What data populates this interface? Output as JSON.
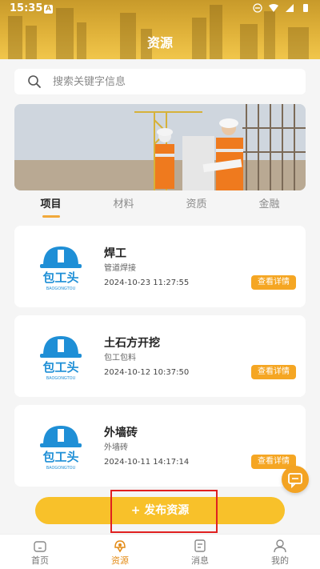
{
  "status_bar": {
    "time": "15:35",
    "app_badge": "A"
  },
  "header": {
    "title": "资源"
  },
  "search": {
    "placeholder": "搜索关键字信息"
  },
  "tabs": [
    {
      "label": "项目",
      "active": true
    },
    {
      "label": "材料",
      "active": false
    },
    {
      "label": "资质",
      "active": false
    },
    {
      "label": "金融",
      "active": false
    }
  ],
  "cards": [
    {
      "title": "焊工",
      "subtitle": "管道焊接",
      "time": "2024-10-23 11:27:55",
      "button": "查看详情",
      "logo_text": "包工头",
      "logo_sub": "BAOGONGTOU"
    },
    {
      "title": "土石方开挖",
      "subtitle": "包工包料",
      "time": "2024-10-12 10:37:50",
      "button": "查看详情",
      "logo_text": "包工头",
      "logo_sub": "BAOGONGTOU"
    },
    {
      "title": "外墙砖",
      "subtitle": "外墙砖",
      "time": "2024-10-11 14:17:14",
      "button": "查看详情",
      "logo_text": "包工头",
      "logo_sub": "BAOGONGTOU"
    }
  ],
  "publish": {
    "label": "+ 发布资源"
  },
  "bottom_nav": [
    {
      "label": "首页",
      "icon": "home-icon",
      "active": false
    },
    {
      "label": "资源",
      "icon": "resource-icon",
      "active": true
    },
    {
      "label": "消息",
      "icon": "message-icon",
      "active": false
    },
    {
      "label": "我的",
      "icon": "profile-icon",
      "active": false
    }
  ],
  "colors": {
    "accent": "#f5a623",
    "publish": "#f8c12a",
    "header": "#e0b23a",
    "active_nav": "#e38b16",
    "logo_blue": "#1f8fd6"
  }
}
